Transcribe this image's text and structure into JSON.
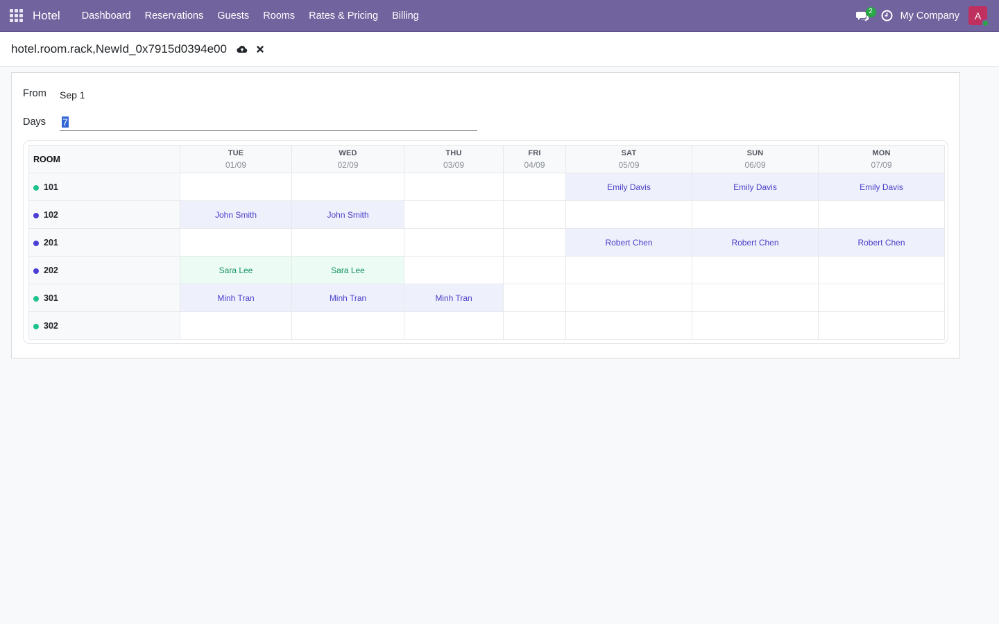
{
  "navbar": {
    "brand": "Hotel",
    "menu": [
      "Dashboard",
      "Reservations",
      "Guests",
      "Rooms",
      "Rates & Pricing",
      "Billing"
    ],
    "chat_count": "2",
    "company": "My Company",
    "avatar_letter": "A"
  },
  "control_panel": {
    "record_title": "hotel.room.rack,NewId_0x7915d0394e00"
  },
  "form": {
    "from_label": "From",
    "from_value": "Sep 1",
    "days_label": "Days",
    "days_value": "7"
  },
  "rack": {
    "room_header": "ROOM",
    "days": [
      {
        "name": "TUE",
        "date": "01/09"
      },
      {
        "name": "WED",
        "date": "02/09"
      },
      {
        "name": "THU",
        "date": "03/09"
      },
      {
        "name": "FRI",
        "date": "04/09"
      },
      {
        "name": "SAT",
        "date": "05/09"
      },
      {
        "name": "SUN",
        "date": "06/09"
      },
      {
        "name": "MON",
        "date": "07/09"
      }
    ],
    "rooms": [
      {
        "number": "101",
        "status_color": "#1ec28b",
        "cells": [
          "",
          "",
          "",
          "",
          "Emily Davis",
          "Emily Davis",
          "Emily Davis"
        ],
        "styles": [
          "",
          "",
          "",
          "",
          "blue",
          "blue",
          "blue"
        ]
      },
      {
        "number": "102",
        "status_color": "#4b3fd6",
        "cells": [
          "John Smith",
          "John Smith",
          "",
          "",
          "",
          "",
          ""
        ],
        "styles": [
          "blue",
          "blue",
          "",
          "",
          "",
          "",
          ""
        ]
      },
      {
        "number": "201",
        "status_color": "#4b3fd6",
        "cells": [
          "",
          "",
          "",
          "",
          "Robert Chen",
          "Robert Chen",
          "Robert Chen"
        ],
        "styles": [
          "",
          "",
          "",
          "",
          "blue",
          "blue",
          "blue"
        ]
      },
      {
        "number": "202",
        "status_color": "#4b3fd6",
        "cells": [
          "Sara Lee",
          "Sara Lee",
          "",
          "",
          "",
          "",
          ""
        ],
        "styles": [
          "green",
          "green",
          "",
          "",
          "",
          "",
          ""
        ]
      },
      {
        "number": "301",
        "status_color": "#1ec28b",
        "cells": [
          "Minh Tran",
          "Minh Tran",
          "Minh Tran",
          "",
          "",
          "",
          ""
        ],
        "styles": [
          "blue",
          "blue",
          "blue",
          "",
          "",
          "",
          ""
        ]
      },
      {
        "number": "302",
        "status_color": "#1ec28b",
        "cells": [
          "",
          "",
          "",
          "",
          "",
          "",
          ""
        ],
        "styles": [
          "",
          "",
          "",
          "",
          "",
          "",
          ""
        ]
      }
    ]
  }
}
